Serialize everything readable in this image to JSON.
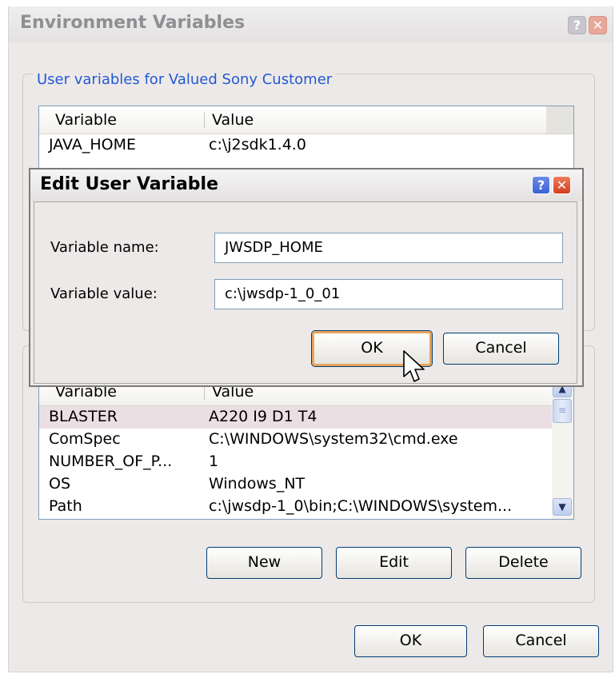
{
  "window": {
    "title": "Environment Variables",
    "help_glyph": "?",
    "close_glyph": "✕"
  },
  "user_vars": {
    "group_label": "User variables for Valued Sony Customer",
    "columns": [
      "Variable",
      "Value"
    ],
    "rows": [
      {
        "variable": "JAVA_HOME",
        "value": "c:\\j2sdk1.4.0"
      }
    ]
  },
  "system_vars": {
    "columns": [
      "Variable",
      "Value"
    ],
    "rows": [
      {
        "variable": "BLASTER",
        "value": "A220 I9 D1 T4"
      },
      {
        "variable": "ComSpec",
        "value": "C:\\WINDOWS\\system32\\cmd.exe"
      },
      {
        "variable": "NUMBER_OF_P...",
        "value": "1"
      },
      {
        "variable": "OS",
        "value": "Windows_NT"
      },
      {
        "variable": "Path",
        "value": "c:\\jwsdp-1_0\\bin;C:\\WINDOWS\\system..."
      }
    ],
    "buttons": {
      "new": "New",
      "edit": "Edit",
      "delete": "Delete"
    }
  },
  "footer": {
    "ok": "OK",
    "cancel": "Cancel"
  },
  "dialog": {
    "title": "Edit User Variable",
    "name_label": "Variable name:",
    "name_value": "JWSDP_HOME",
    "value_label": "Variable value:",
    "value_value": "c:\\jwsdp-1_0_01",
    "ok": "OK",
    "cancel": "Cancel"
  },
  "icons": {
    "scroll_up": "▲",
    "scroll_down": "▼",
    "thumb_grip": "≡",
    "cursor": "arrow-pointer-icon"
  }
}
